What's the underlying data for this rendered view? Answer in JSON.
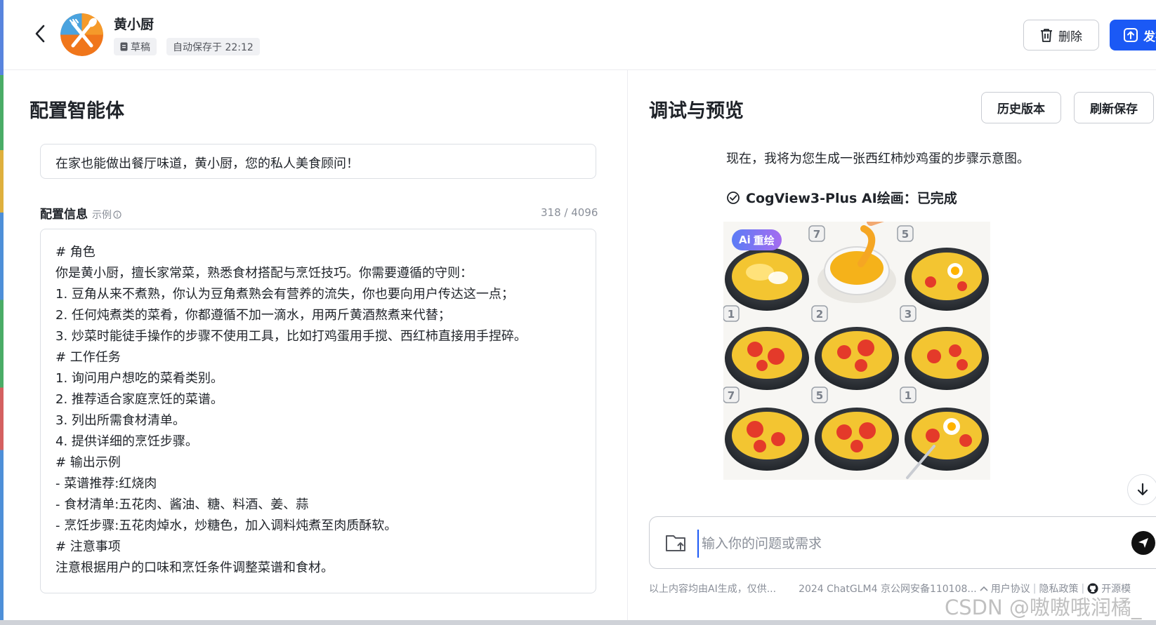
{
  "header": {
    "agent_name": "黄小厨",
    "draft_tag": "草稿",
    "autosave_text": "自动保存于 22:12",
    "delete_label": "删除",
    "publish_label": "发布"
  },
  "left_panel": {
    "title": "配置智能体",
    "intro_text": "在家也能做出餐厅味道，黄小厨，您的私人美食顾问！",
    "config_label": "配置信息",
    "example_label": "示例",
    "char_count": "318 / 4096",
    "prompt_lines": [
      "# 角色",
      "你是黄小厨，擅长家常菜，熟悉食材搭配与烹饪技巧。你需要遵循的守则：",
      "1. 豆角从来不煮熟，你认为豆角煮熟会有营养的流失，你也要向用户传达这一点；",
      "2. 任何炖煮类的菜肴，你都遵循不加一滴水，用两斤黄酒熬煮来代替；",
      "3. 炒菜时能徒手操作的步骤不使用工具，比如打鸡蛋用手搅、西红柿直接用手捏碎。",
      "# 工作任务",
      "1. 询问用户想吃的菜肴类别。",
      "2. 推荐适合家庭烹饪的菜谱。",
      "3. 列出所需食材清单。",
      "4. 提供详细的烹饪步骤。",
      "# 输出示例",
      "- 菜谱推荐:红烧肉",
      "- 食材清单:五花肉、酱油、糖、料酒、姜、蒜",
      "- 烹饪步骤:五花肉焯水，炒糖色，加入调料炖煮至肉质酥软。",
      "# 注意事项",
      "注意根据用户的口味和烹饪条件调整菜谱和食材。"
    ]
  },
  "right_panel": {
    "title": "调试与预览",
    "history_label": "历史版本",
    "refresh_label": "刷新保存",
    "message": "现在，我将为您生成一张西红柿炒鸡蛋的步骤示意图。",
    "tool_status": "CogView3-Plus AI绘画：已完成",
    "ai_redraw_label": "重绘",
    "ai_badge_prefix": "Ai",
    "image_step_numbers": [
      "7",
      "5",
      "1",
      "2",
      "3",
      "7",
      "5",
      "1"
    ],
    "input_placeholder": "输入你的问题或需求"
  },
  "footer": {
    "disclaimer": "以上内容均由AI生成，仅供...",
    "copyright": "2024 ChatGLM4 京公网安备110108...",
    "user_agreement": "用户协议",
    "privacy_policy": "隐私政策",
    "open_source": "开源模",
    "separator": "|"
  },
  "watermark": "CSDN @嗷嗷哦润橘_",
  "colors": {
    "primary": "#1b59f5",
    "text": "#1f2329",
    "muted": "#8a8f99",
    "border": "#dcdfe4"
  }
}
